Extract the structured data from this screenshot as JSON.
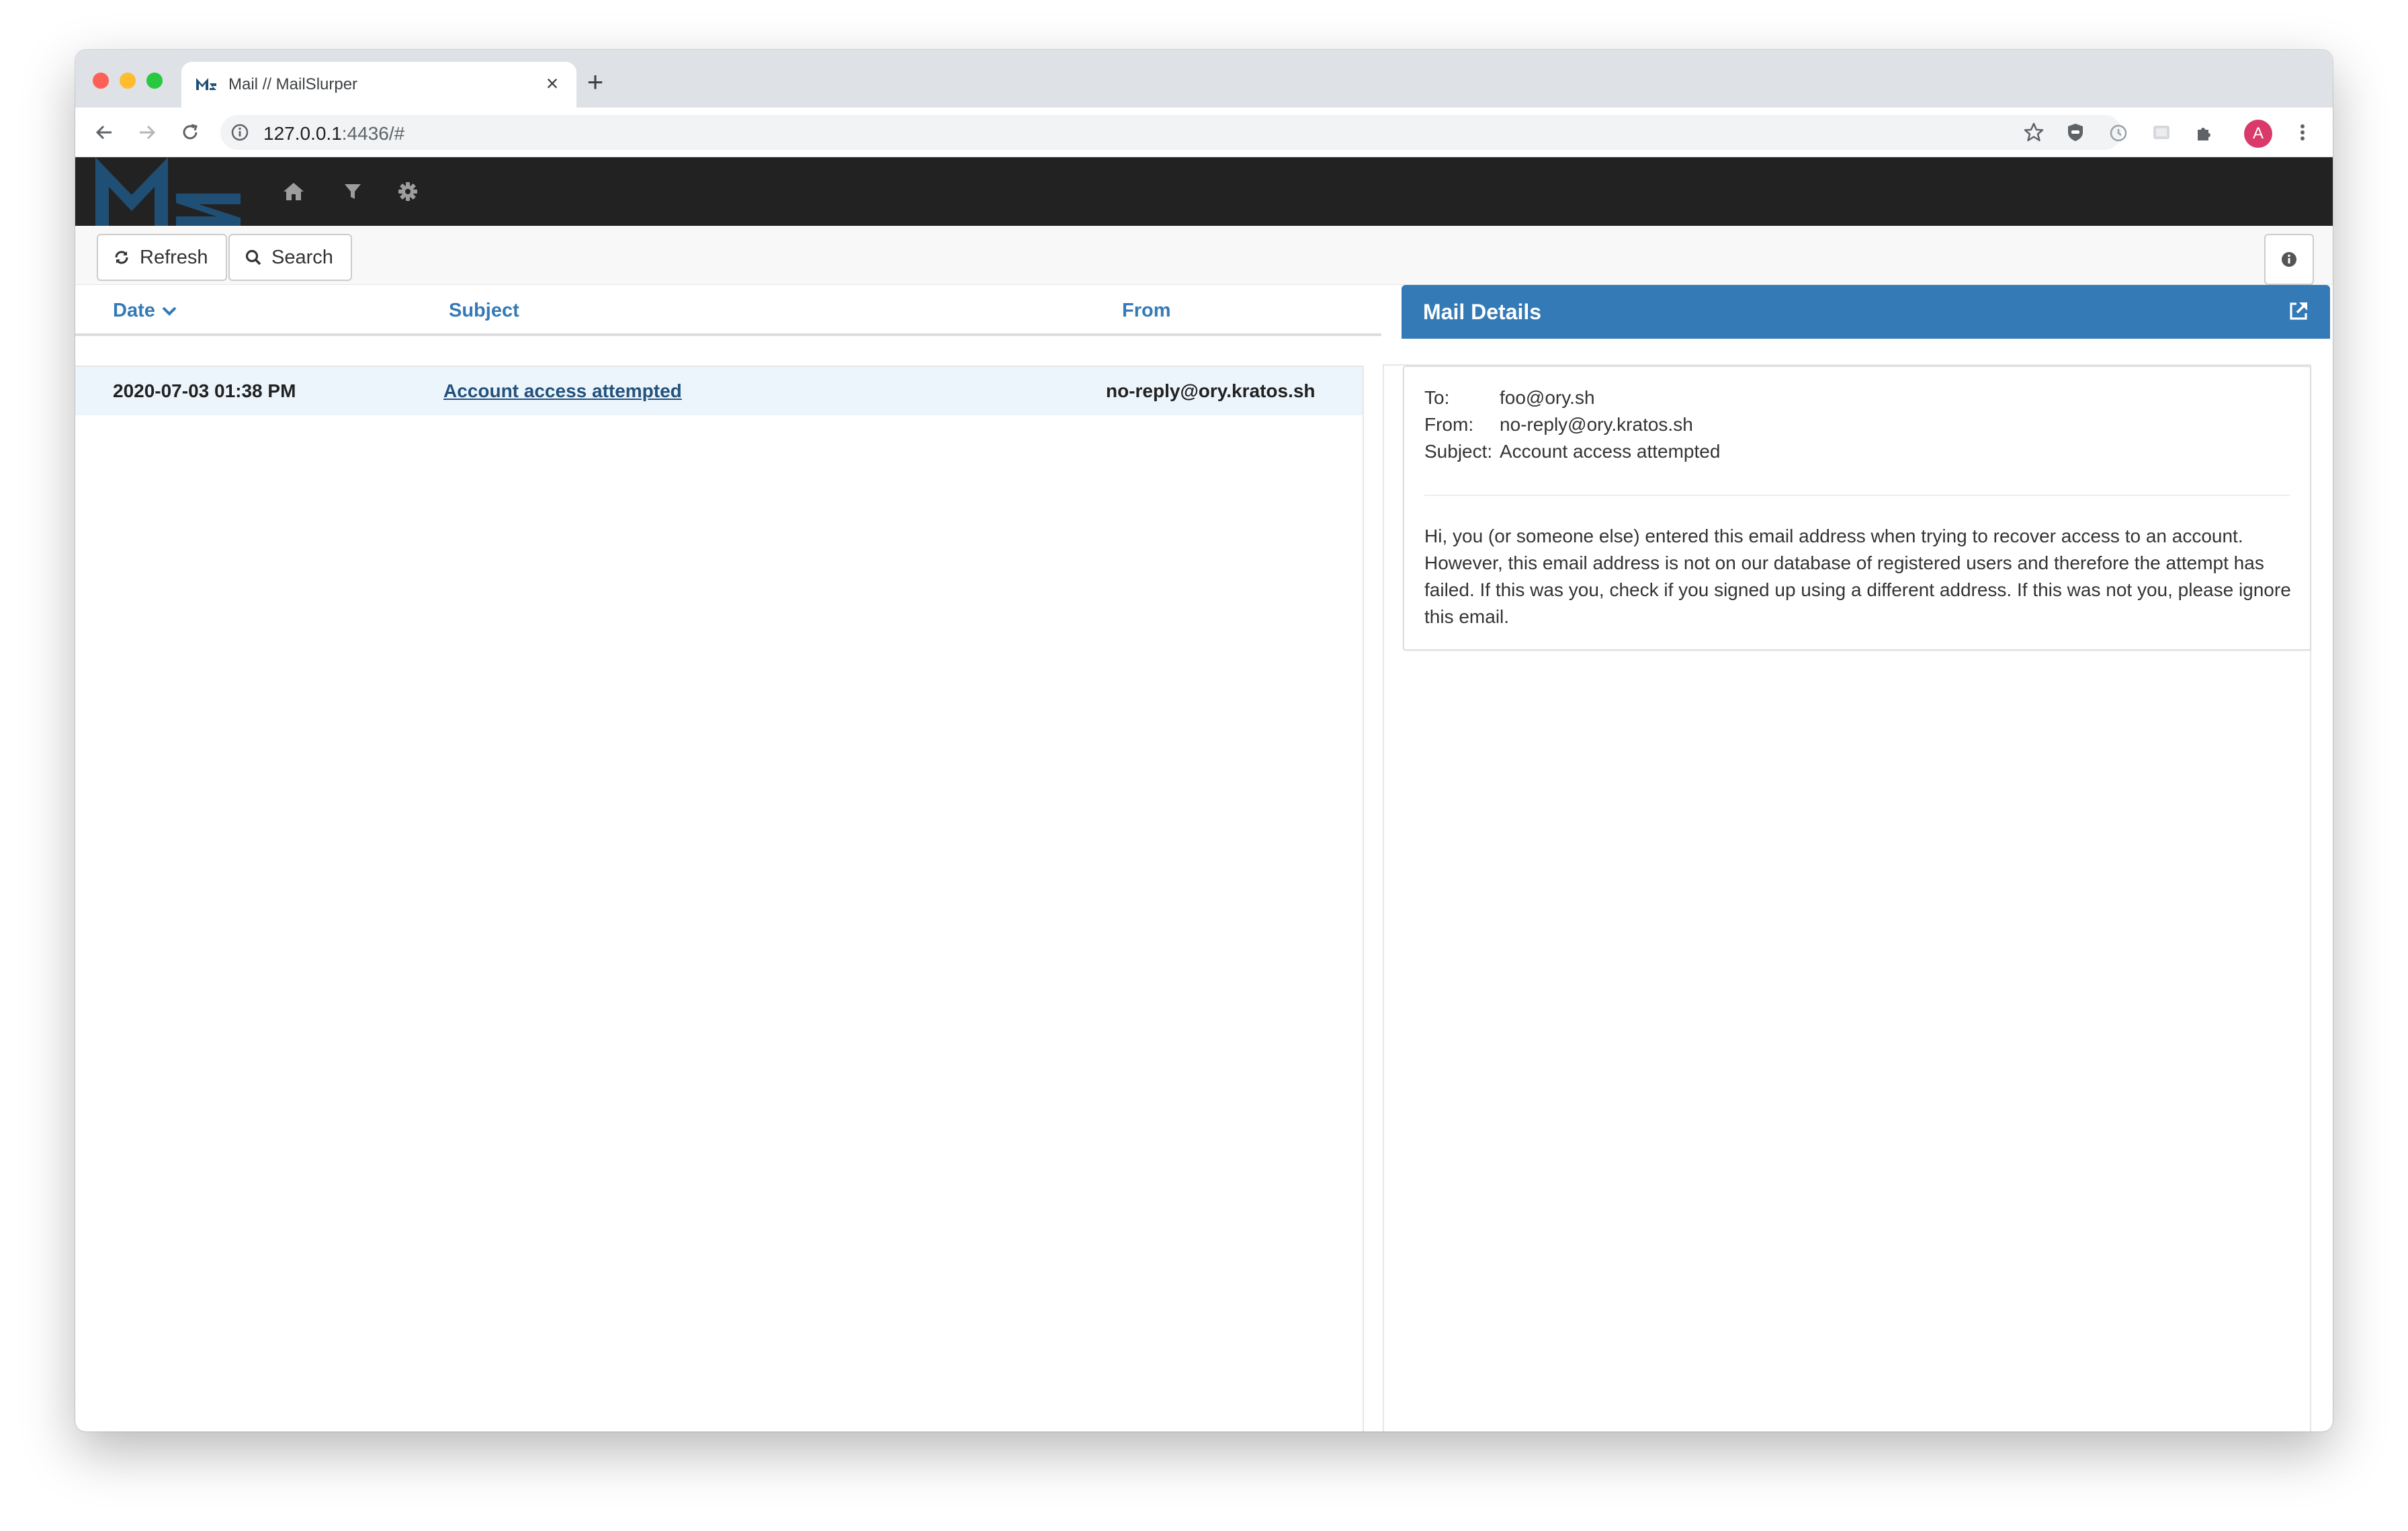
{
  "browser": {
    "tab_title": "Mail // MailSlurper",
    "url_host": "127.0.0.1",
    "url_rest": ":4436/#",
    "profile_initial": "A"
  },
  "actions": {
    "refresh_label": "Refresh",
    "search_label": "Search"
  },
  "list": {
    "columns": {
      "date": "Date",
      "subject": "Subject",
      "from": "From"
    },
    "rows": [
      {
        "date": "2020-07-03 01:38 PM",
        "subject": "Account access attempted",
        "from": "no-reply@ory.kratos.sh"
      }
    ]
  },
  "details": {
    "title": "Mail Details",
    "to_label": "To:",
    "to": "foo@ory.sh",
    "from_label": "From:",
    "from": "no-reply@ory.kratos.sh",
    "subject_label": "Subject:",
    "subject": "Account access attempted",
    "body": "Hi, you (or someone else) entered this email address when trying to recover access to an account. However, this email address is not on our database of registered users and therefore the attempt has failed. If this was you, check if you signed up using a different address. If this was not you, please ignore this email."
  },
  "colors": {
    "accent": "#337ab7",
    "navbar": "#222222",
    "selected_row": "#edf5fc"
  }
}
